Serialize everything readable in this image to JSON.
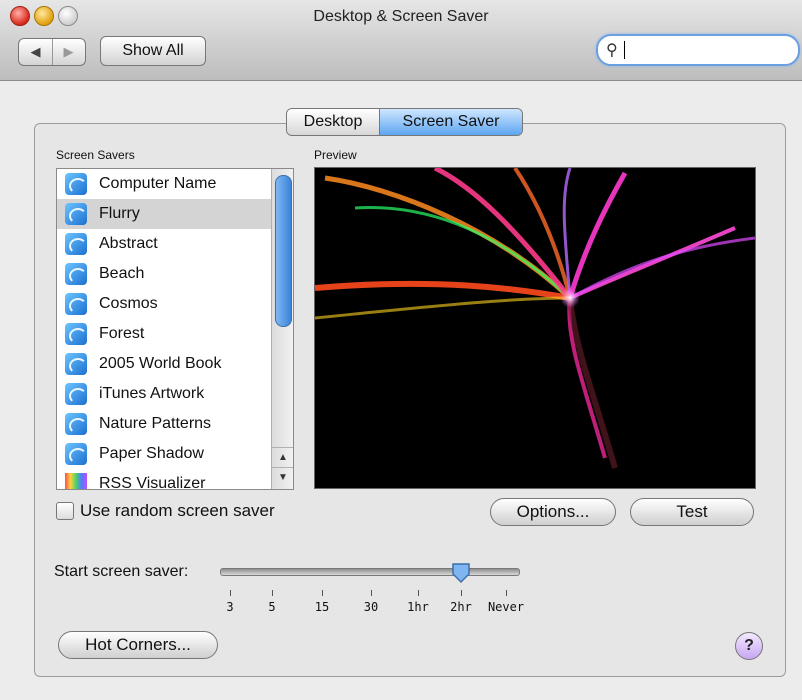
{
  "window": {
    "title": "Desktop & Screen Saver"
  },
  "toolbar": {
    "back_glyph": "◀",
    "forward_glyph": "▶",
    "show_all": "Show All",
    "search_icon": "magnifier-icon",
    "search_glyph": "⚲",
    "search_value": ""
  },
  "tabs": [
    {
      "label": "Desktop"
    },
    {
      "label": "Screen Saver",
      "active": true
    }
  ],
  "screen_savers": {
    "label": "Screen Savers",
    "items": [
      {
        "label": "Computer Name"
      },
      {
        "label": "Flurry",
        "selected": true
      },
      {
        "label": "Abstract"
      },
      {
        "label": "Beach"
      },
      {
        "label": "Cosmos"
      },
      {
        "label": "Forest"
      },
      {
        "label": "2005 World Book"
      },
      {
        "label": "iTunes Artwork"
      },
      {
        "label": "Nature Patterns"
      },
      {
        "label": "Paper Shadow"
      },
      {
        "label": "RSS Visualizer"
      }
    ]
  },
  "preview": {
    "label": "Preview"
  },
  "random": {
    "label": "Use random screen saver",
    "checked": false
  },
  "buttons": {
    "options": "Options...",
    "test": "Test",
    "hot_corners": "Hot Corners..."
  },
  "start": {
    "label": "Start screen saver:",
    "ticks": [
      "3",
      "5",
      "15",
      "30",
      "1hr",
      "2hr",
      "Never"
    ],
    "selected": "2hr"
  },
  "help": {
    "glyph": "?"
  },
  "colors": {
    "accent": "#5ea6f2",
    "preview_bg": "#000000"
  }
}
